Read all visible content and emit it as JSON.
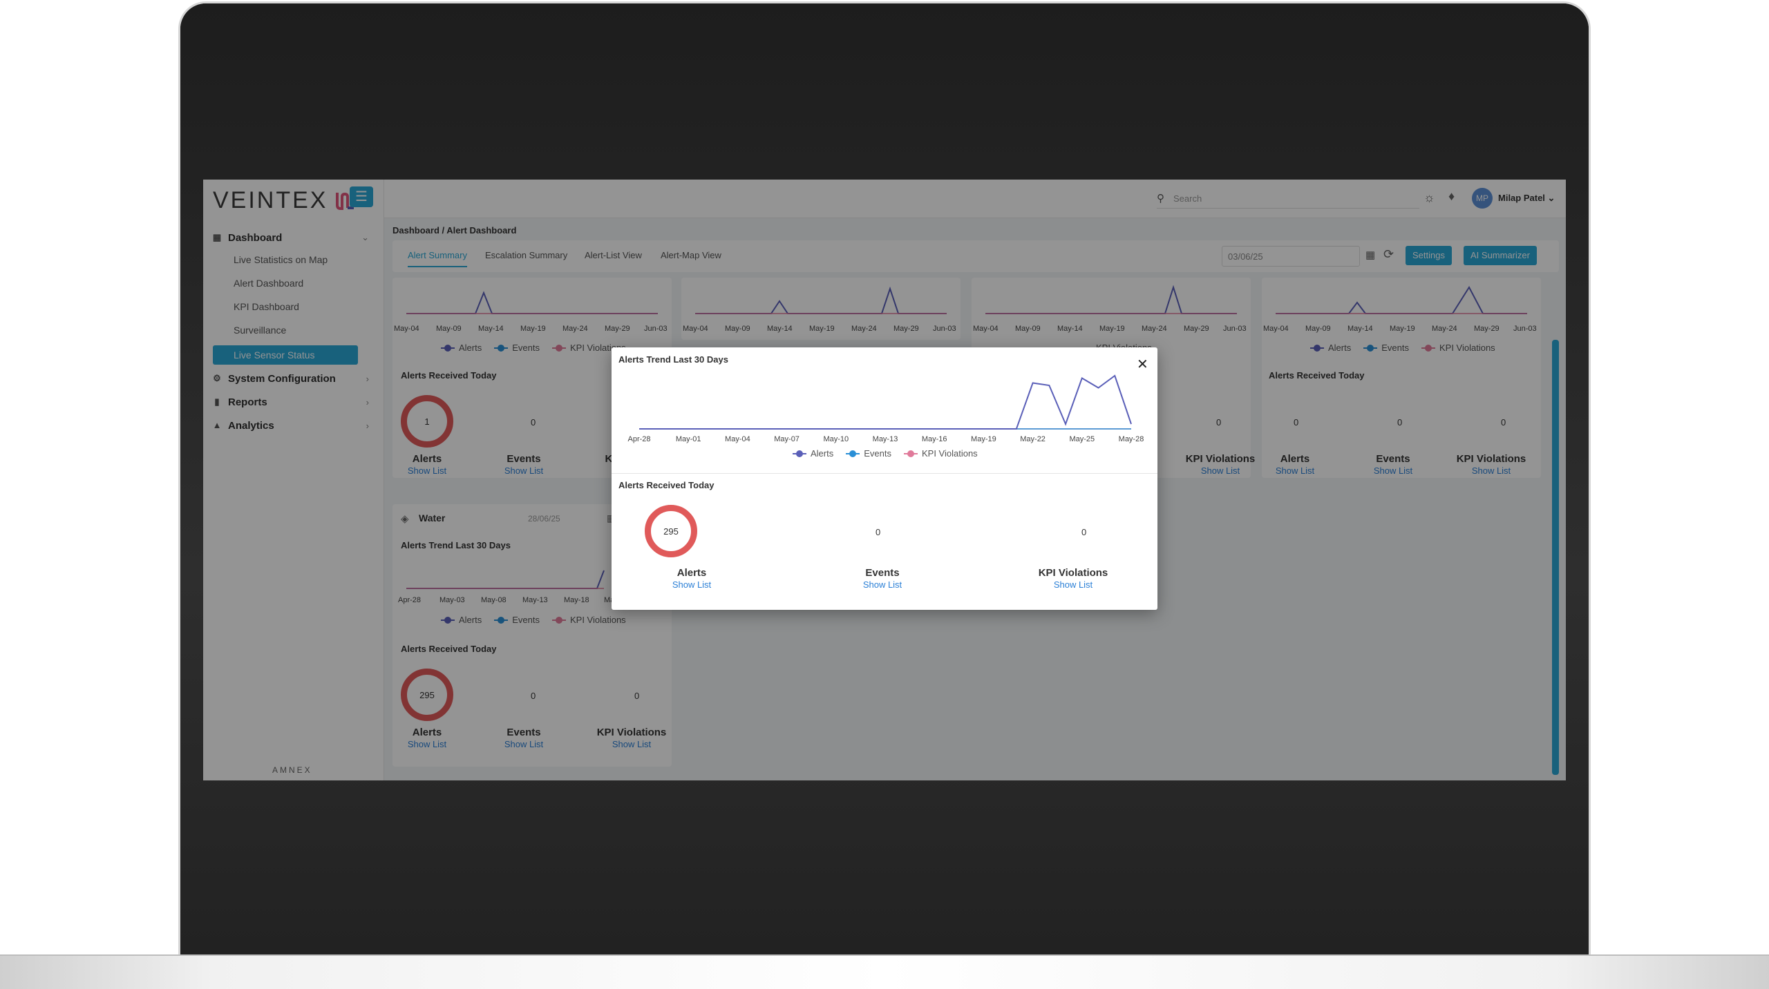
{
  "app": {
    "logo_text": "VEINTEX",
    "footer_brand": "AMNEX",
    "menu_icon": "hamburger-icon"
  },
  "sidebar": {
    "dashboard_label": "Dashboard",
    "sub_items": [
      "Live Statistics on Map",
      "Alert Dashboard",
      "KPI Dashboard",
      "Surveillance",
      "Live Sensor Status"
    ],
    "active_sub": "Live Sensor Status",
    "system_config": "System Configuration",
    "reports": "Reports",
    "analytics": "Analytics"
  },
  "header": {
    "search_placeholder": "Search",
    "avatar_initials": "MP",
    "username": "Milap Patel"
  },
  "breadcrumb": "Dashboard / Alert Dashboard",
  "tabs": [
    "Alert Summary",
    "Escalation Summary",
    "Alert-List View",
    "Alert-Map View"
  ],
  "toolbar": {
    "date": "03/06/25",
    "settings_label": "Settings",
    "ai_label": "AI Summarizer"
  },
  "legend": [
    "Alerts",
    "Events",
    "KPI Violations"
  ],
  "colors": {
    "accent": "#2aa7d6",
    "alerts": "#5a5fb8",
    "events": "#2a8fd6",
    "kpi": "#e07a9a",
    "donut": "#e05a5a"
  },
  "cards": {
    "top_ticks": [
      "May-04",
      "May-09",
      "May-14",
      "May-19",
      "May-24",
      "May-29",
      "Jun-03"
    ],
    "received_title": "Alerts Received Today",
    "card1": {
      "alerts": "1",
      "events": "0"
    },
    "card3": {
      "kpi": "0"
    },
    "card4": {
      "alerts": "0",
      "events": "0",
      "kpi": "0"
    },
    "labels": {
      "alerts": "Alerts",
      "events": "Events",
      "kpi": "KPI Violations",
      "kpi_short": "KPI",
      "show_list": "Show List"
    },
    "water": {
      "name": "Water",
      "date": "28/06/25",
      "trend_title": "Alerts Trend Last 30 Days",
      "ticks": [
        "Apr-28",
        "May-03",
        "May-08",
        "May-13",
        "May-18",
        "Ma"
      ],
      "alerts": "295",
      "events": "0",
      "kpi": "0"
    }
  },
  "modal": {
    "trend_title": "Alerts Trend Last 30 Days",
    "received_title": "Alerts Received Today",
    "alerts": "295",
    "events": "0",
    "kpi": "0",
    "alerts_label": "Alerts",
    "events_label": "Events",
    "kpi_label": "KPI Violations",
    "show_list": "Show List",
    "close_icon": "close-icon"
  },
  "chart_data": {
    "type": "line",
    "title": "Alerts Trend Last 30 Days",
    "x": [
      "Apr-28",
      "Apr-29",
      "Apr-30",
      "May-01",
      "May-02",
      "May-03",
      "May-04",
      "May-05",
      "May-06",
      "May-07",
      "May-08",
      "May-09",
      "May-10",
      "May-11",
      "May-12",
      "May-13",
      "May-14",
      "May-15",
      "May-16",
      "May-17",
      "May-18",
      "May-19",
      "May-20",
      "May-21",
      "May-22",
      "May-23",
      "May-24",
      "May-25",
      "May-26",
      "May-27",
      "May-28"
    ],
    "x_ticks": [
      "Apr-28",
      "May-01",
      "May-04",
      "May-07",
      "May-10",
      "May-13",
      "May-16",
      "May-19",
      "May-22",
      "May-25",
      "May-28"
    ],
    "series": [
      {
        "name": "Alerts",
        "values": [
          0,
          0,
          0,
          0,
          0,
          0,
          0,
          0,
          0,
          0,
          0,
          0,
          0,
          0,
          0,
          0,
          0,
          0,
          0,
          0,
          0,
          0,
          0,
          0,
          95,
          90,
          10,
          105,
          85,
          110,
          10
        ]
      },
      {
        "name": "Events",
        "values": [
          0,
          0,
          0,
          0,
          0,
          0,
          0,
          0,
          0,
          0,
          0,
          0,
          0,
          0,
          0,
          0,
          0,
          0,
          0,
          0,
          0,
          0,
          0,
          0,
          0,
          0,
          0,
          0,
          0,
          0,
          0
        ]
      },
      {
        "name": "KPI Violations",
        "values": [
          0,
          0,
          0,
          0,
          0,
          0,
          0,
          0,
          0,
          0,
          0,
          0,
          0,
          0,
          0,
          0,
          0,
          0,
          0,
          0,
          0,
          0,
          0,
          0,
          0,
          0,
          0,
          0,
          0,
          0,
          0
        ]
      }
    ],
    "legend": "bottom",
    "grid": false
  }
}
